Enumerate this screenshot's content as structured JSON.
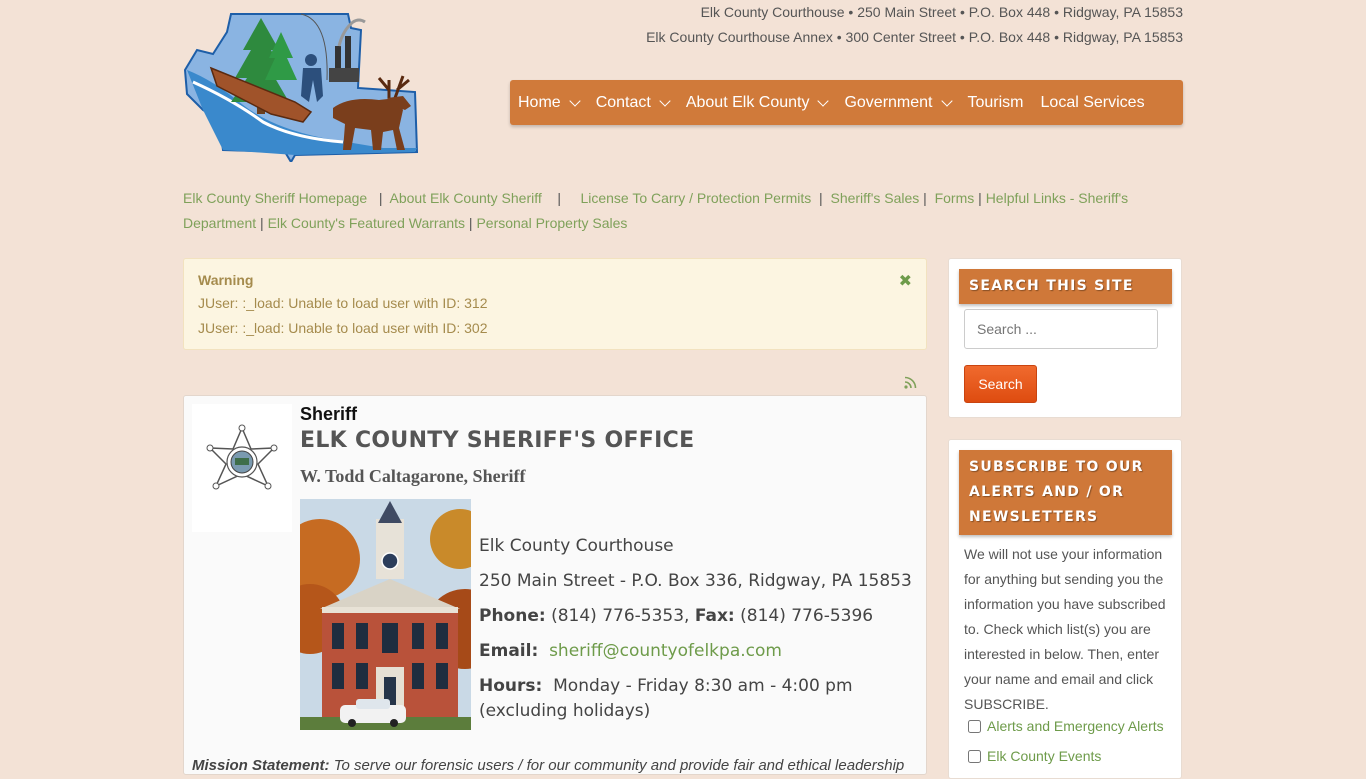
{
  "header": {
    "address_1": "Elk County Courthouse • 250 Main Street • P.O. Box 448 • Ridgway, PA 15853",
    "address_2": "Elk County Courthouse Annex • 300 Center Street • P.O. Box 448 • Ridgway, PA 15853"
  },
  "nav": {
    "items": [
      {
        "label": "Home",
        "has_dropdown": true
      },
      {
        "label": "Contact",
        "has_dropdown": true
      },
      {
        "label": "About Elk County",
        "has_dropdown": true
      },
      {
        "label": "Government",
        "has_dropdown": true
      },
      {
        "label": "Tourism",
        "has_dropdown": false
      },
      {
        "label": "Local Services",
        "has_dropdown": false
      }
    ]
  },
  "sublinks": {
    "items": [
      "Elk County Sheriff Homepage",
      "About Elk County Sheriff",
      "License To Carry / Protection Permits",
      "Sheriff's Sales",
      "Forms",
      "Helpful Links - Sheriff's Department",
      "Elk County's Featured Warrants",
      "Personal Property Sales"
    ]
  },
  "warning": {
    "title": "Warning",
    "messages": [
      "JUser: :_load: Unable to load user with ID: 312",
      "JUser: :_load: Unable to load user with ID: 302"
    ],
    "close_glyph": "✖"
  },
  "article": {
    "category": "Sheriff",
    "title": "ELK COUNTY SHERIFF'S OFFICE",
    "sheriff_name": "W. Todd Caltagarone, Sheriff",
    "location": "Elk County Courthouse",
    "address": "250 Main Street - P.O. Box 336, Ridgway, PA 15853",
    "phone_label": "Phone:",
    "phone": "(814) 776-5353,",
    "fax_label": "Fax:",
    "fax": "(814) 776-5396",
    "email_label": "Email:",
    "email": "sheriff@countyofelkpa.com",
    "hours_label": "Hours:",
    "hours": "Monday - Friday 8:30 am - 4:00 pm",
    "hours_note": "(excluding holidays)",
    "mission_label": "Mission Statement:",
    "mission_text": "To serve our forensic users / for our community and provide fair and ethical leadership"
  },
  "sidebar": {
    "search": {
      "heading": "SEARCH THIS SITE",
      "placeholder": "Search ...",
      "button": "Search"
    },
    "subscribe": {
      "heading": "SUBSCRIBE TO OUR ALERTS AND / OR NEWSLETTERS",
      "description": "We will not use your information for anything but sending you the information you have subscribed to. Check which list(s) you are interested in below. Then, enter your name and email and click SUBSCRIBE.",
      "options": [
        "Alerts and Emergency Alerts",
        "Elk County Events"
      ]
    }
  },
  "colors": {
    "background": "#f3e2d6",
    "nav_bg": "#d07a3a",
    "link": "#6e9b4a",
    "search_button": "#e9581c"
  }
}
